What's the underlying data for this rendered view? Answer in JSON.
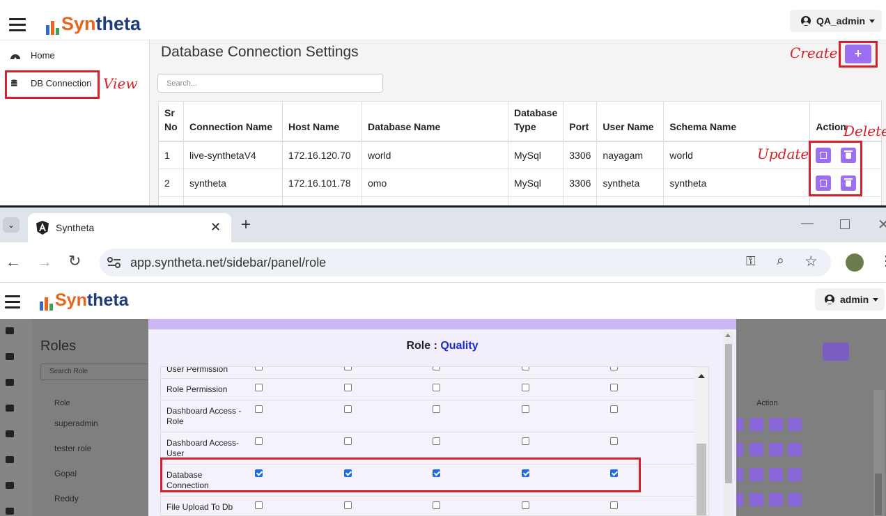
{
  "top_app": {
    "logo": {
      "part1": "Syn",
      "part2": "theta"
    },
    "user_menu": {
      "label": "QA_admin"
    },
    "sidebar": [
      {
        "label": "Home",
        "icon": "dashboard-icon"
      },
      {
        "label": "DB Connection",
        "icon": "database-icon"
      }
    ],
    "page_title": "Database Connection Settings",
    "search_placeholder": "Search...",
    "create_button": "+",
    "table": {
      "headers": [
        "Sr No",
        "Connection Name",
        "Host Name",
        "Database Name",
        "Database Type",
        "Port",
        "User Name",
        "Schema Name",
        "Action"
      ],
      "rows": [
        [
          "1",
          "live-synthetaV4",
          "172.16.120.70",
          "world",
          "MySql",
          "3306",
          "nayagam",
          "world"
        ],
        [
          "2",
          "syntheta",
          "172.16.101.78",
          "omo",
          "MySql",
          "3306",
          "syntheta",
          "syntheta"
        ]
      ]
    },
    "annotations": {
      "view": "View",
      "create": "Create",
      "update": "Update",
      "delete": "Delete"
    },
    "annotation_color": "#d8202a",
    "accent_color": "#9b6ff0"
  },
  "browser": {
    "tab_title": "Syntheta",
    "url": "app.syntheta.net/sidebar/panel/role",
    "app": {
      "logo": {
        "part1": "Syn",
        "part2": "theta"
      },
      "user_menu": {
        "label": "admin"
      },
      "page_title": "Roles",
      "search_placeholder": "Search Role",
      "role_column": "Role",
      "action_column": "Action",
      "roles": [
        "superadmin",
        "tester role",
        "Gopal",
        "Reddy"
      ],
      "modal": {
        "title_prefix": "Role : ",
        "role_name": "Quality",
        "permissions": [
          {
            "label": "User Permission",
            "checked": [
              false,
              false,
              false,
              false,
              false
            ]
          },
          {
            "label": "Role Permission",
            "checked": [
              false,
              false,
              false,
              false,
              false
            ]
          },
          {
            "label": "Dashboard Access - Role",
            "checked": [
              false,
              false,
              false,
              false,
              false
            ]
          },
          {
            "label": "Dashboard Access- User",
            "checked": [
              false,
              false,
              false,
              false,
              false
            ]
          },
          {
            "label": "Database Connection",
            "checked": [
              true,
              true,
              true,
              true,
              true
            ]
          },
          {
            "label": "File Upload To Db",
            "checked": [
              false,
              false,
              false,
              false,
              false
            ]
          }
        ]
      }
    }
  }
}
